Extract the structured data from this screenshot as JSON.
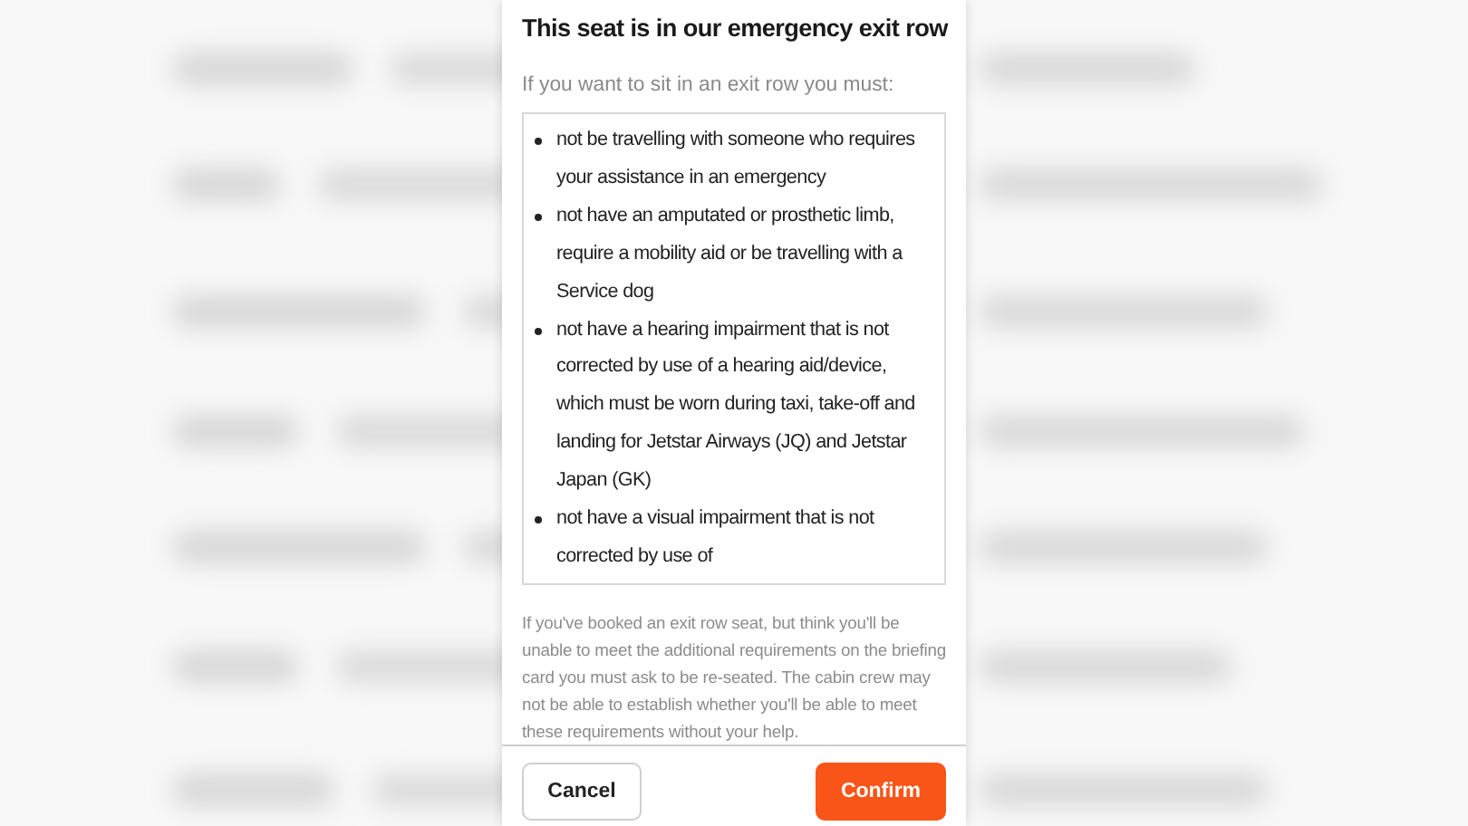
{
  "dialog": {
    "title": "This seat is in our emergency exit row",
    "intro": "If you want to sit in an exit row you must:",
    "requirements": [
      "not be travelling with someone who requires your assistance in an emergency",
      "not have an amputated or prosthetic limb, require a mobility aid or be travelling with a Service dog",
      "not have a hearing impairment that is not corrected by use of a hearing aid/device, which must be worn during taxi, take-off and landing for Jetstar Airways (JQ) and Jetstar Japan (GK)",
      "not have a visual impairment that is not corrected by use of"
    ],
    "note": "If you've booked an exit row seat, but think you'll be unable to meet the additional requirements on the briefing card you must ask to be re-seated. The cabin crew may not be able to establish whether you'll be able to meet these requirements without your help.",
    "buttons": [
      {
        "label": "Cancel",
        "kind": "secondary"
      },
      {
        "label": "Confirm",
        "kind": "primary"
      }
    ]
  }
}
